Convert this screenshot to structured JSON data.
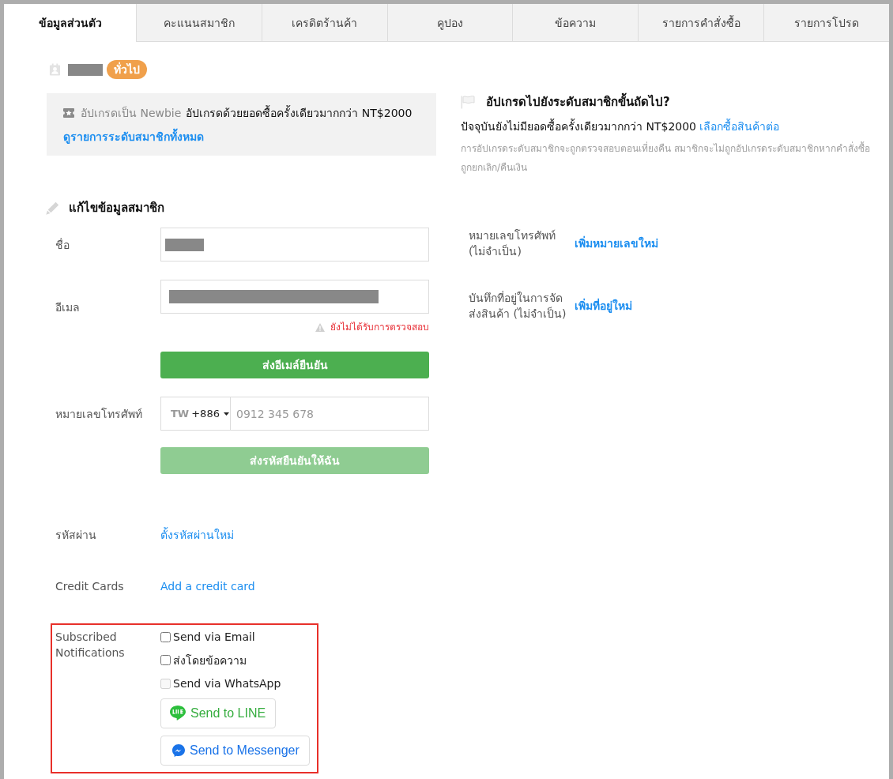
{
  "tabs": [
    {
      "label": "ข้อมูลส่วนตัว",
      "selected": true
    },
    {
      "label": "คะแนนสมาชิก",
      "selected": false
    },
    {
      "label": "เครดิตร้านค้า",
      "selected": false
    },
    {
      "label": "คูปอง",
      "selected": false
    },
    {
      "label": "ข้อความ",
      "selected": false
    },
    {
      "label": "รายการคำสั่งซื้อ",
      "selected": false
    },
    {
      "label": "รายการโปรด",
      "selected": false
    }
  ],
  "member": {
    "name_redacted": true,
    "tier_badge": "ทั่วไป"
  },
  "upgrade_box": {
    "label": "อัปเกรดเป็น Newbie",
    "condition": "อัปเกรดด้วยยอดซื้อครั้งเดียวมากกว่า NT$2000",
    "link": "ดูรายการระดับสมาชิกทั้งหมด"
  },
  "next_level": {
    "title": "อัปเกรดไปยังระดับสมาชิกขั้นถัดไป?",
    "status": "ปัจจุบันยังไม่มียอดซื้อครั้งเดียวมากกว่า NT$2000",
    "link": "เลือกซื้อสินค้าต่อ",
    "note": "การอัปเกรดระดับสมาชิกจะถูกตรวจสอบตอนเที่ยงคืน สมาชิกจะไม่ถูกอัปเกรดระดับสมาชิกหากคำสั่งซื้อถูกยกเลิก/คืนเงิน"
  },
  "edit_section": {
    "title": "แก้ไขข้อมูลสมาชิก"
  },
  "form": [
    {
      "kind": "input",
      "label": "ชื่อ",
      "redacted": true
    },
    {
      "kind": "input",
      "label": "อีเมล",
      "redacted": true,
      "warning": "ยังไม่ได้รับการตรวจสอบ",
      "button": {
        "label": "ส่งอีเมล์ยืนยัน",
        "disabled": false
      }
    },
    {
      "kind": "phone",
      "label": "หมายเลขโทรศัพท์",
      "country": "TW",
      "code": "+886",
      "placeholder": "0912 345 678",
      "button": {
        "label": "ส่งรหัสยืนยันให้ฉัน",
        "disabled": true
      }
    },
    {
      "kind": "link",
      "label": "รหัสผ่าน",
      "link": "ตั้งรหัสผ่านใหม่"
    },
    {
      "kind": "link",
      "label": "Credit Cards",
      "link": "Add a credit card"
    },
    {
      "kind": "notifications",
      "label": "Subscribed Notifications",
      "highlighted": true,
      "options": [
        {
          "label": "Send via Email",
          "checked": false,
          "disabled": false
        },
        {
          "label": "ส่งโดยข้อความ",
          "checked": false,
          "disabled": false
        },
        {
          "label": "Send via WhatsApp",
          "checked": false,
          "disabled": true
        }
      ],
      "buttons": [
        {
          "kind": "line",
          "label": "Send to LINE"
        },
        {
          "kind": "messenger",
          "label": "Send to Messenger"
        }
      ]
    }
  ],
  "side_form": [
    {
      "label": "หมายเลขโทรศัพท์ (ไม่จำเป็น)",
      "link": "เพิ่มหมายเลขใหม่"
    },
    {
      "label": "บันทึกที่อยู่ในการจัดส่งสินค้า (ไม่จำเป็น)",
      "link": "เพิ่มที่อยู่ใหม่"
    }
  ]
}
